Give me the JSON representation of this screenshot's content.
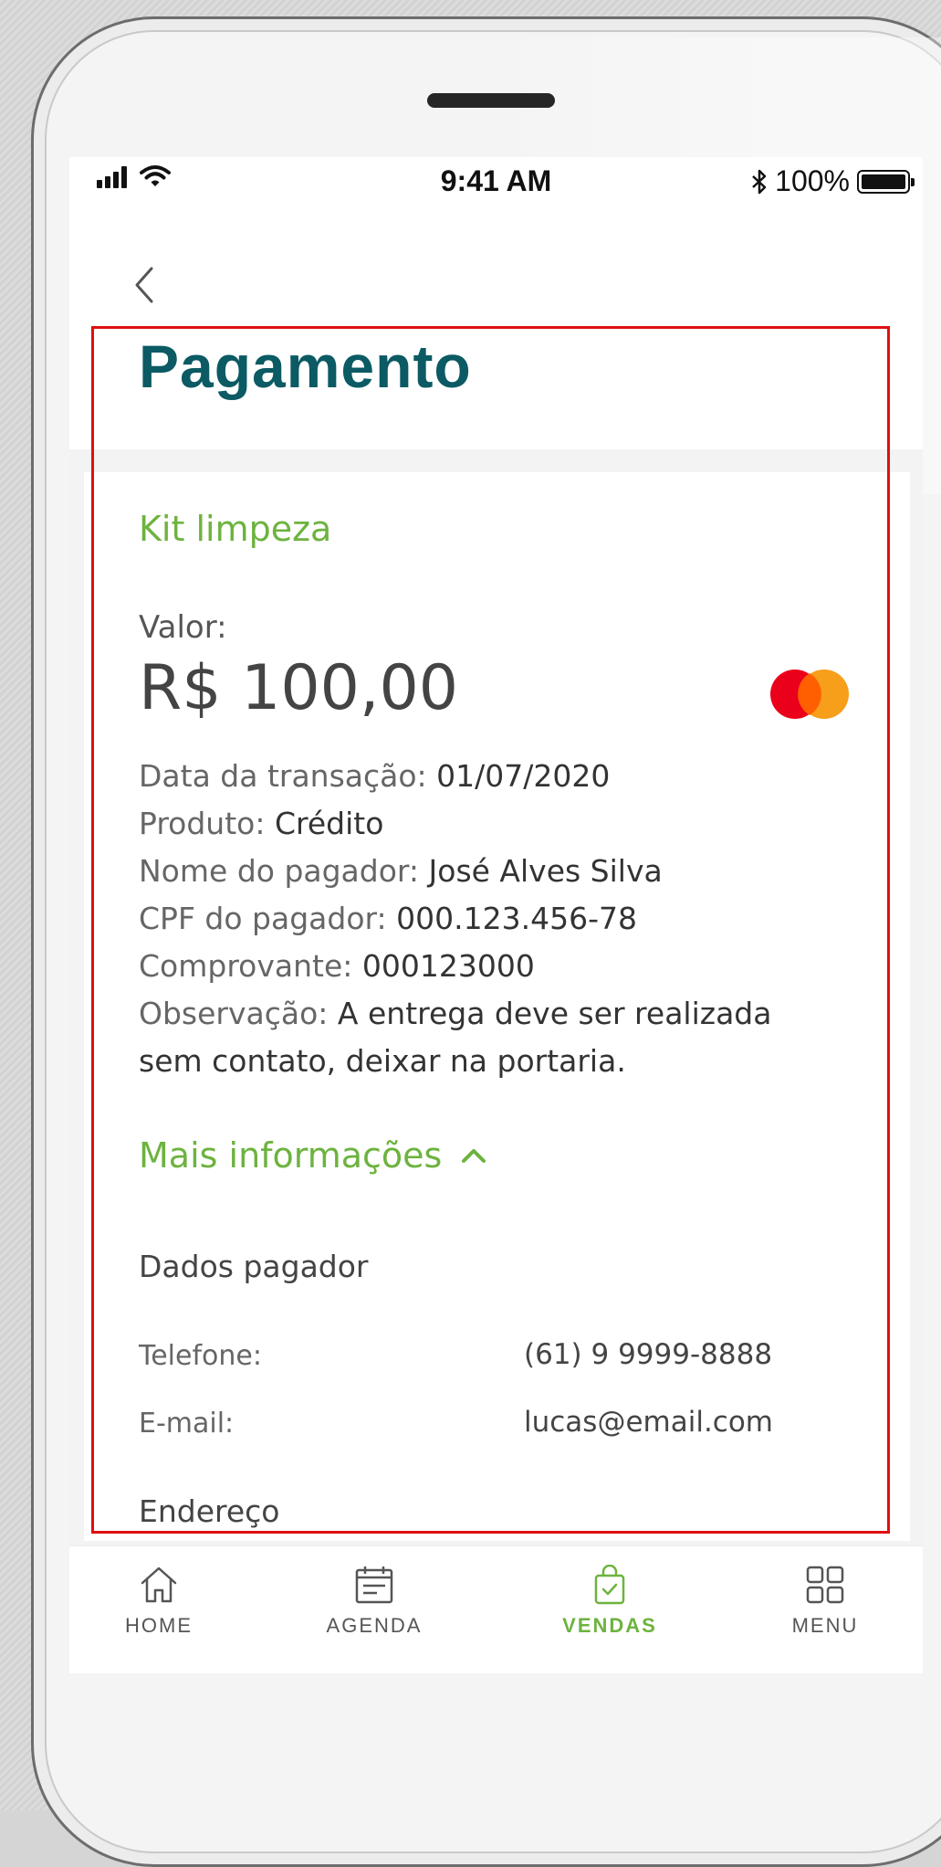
{
  "status_bar": {
    "time": "9:41 AM",
    "battery": "100%"
  },
  "page": {
    "title": "Pagamento"
  },
  "payment": {
    "product_name": "Kit limpeza",
    "valor_label": "Valor:",
    "amount": "R$ 100,00",
    "card_brand": "mastercard-icon",
    "details": [
      {
        "label": "Data da transação: ",
        "value": "01/07/2020"
      },
      {
        "label": "Produto: ",
        "value": "Crédito"
      },
      {
        "label": "Nome do pagador: ",
        "value": "José Alves Silva"
      },
      {
        "label": "CPF do pagador: ",
        "value": "000.123.456-78"
      },
      {
        "label": "Comprovante: ",
        "value": "000123000"
      }
    ],
    "observation": {
      "label": "Observação: ",
      "value_line1": "A entrega deve ser realizada",
      "value_line2": "sem contato, deixar na portaria."
    },
    "more_info_label": "Mais informações",
    "payer_section_title": "Dados pagador",
    "phone_label": "Telefone:",
    "phone_value": "(61) 9 9999-8888",
    "email_label": "E-mail:",
    "email_value": "lucas@email.com",
    "address_section_title": "Endereço"
  },
  "tabbar": {
    "items": [
      {
        "label": "HOME",
        "icon": "home-icon",
        "active": false
      },
      {
        "label": "AGENDA",
        "icon": "calendar-icon",
        "active": false
      },
      {
        "label": "VENDAS",
        "icon": "shopping-bag-icon",
        "active": true
      },
      {
        "label": "MENU",
        "icon": "grid-icon",
        "active": false
      }
    ]
  },
  "colors": {
    "title": "#0b5a64",
    "accent_green": "#6db33f",
    "highlight_border": "#e01010"
  }
}
